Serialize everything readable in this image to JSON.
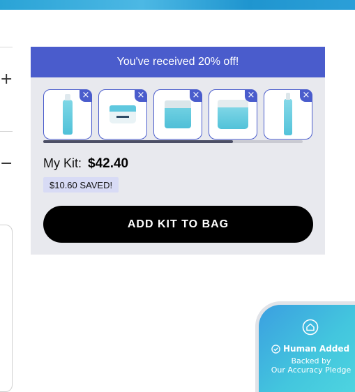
{
  "header_banner": {},
  "left_controls": {
    "expand_symbol": "+",
    "collapse_symbol": "−"
  },
  "kit": {
    "discount_message": "You've received 20% off!",
    "items": [
      {
        "name": "toner-bottle",
        "icon": "product-bottle-icon"
      },
      {
        "name": "gel-cream-jar",
        "icon": "product-jar-icon"
      },
      {
        "name": "moisturizer-jar",
        "icon": "product-jar-icon"
      },
      {
        "name": "cleansing-balm-jar",
        "icon": "product-jar-icon"
      },
      {
        "name": "serum-bottle",
        "icon": "product-bottle-icon"
      }
    ],
    "remove_symbol": "×",
    "scroll_position_fraction": 0.73,
    "total_label": "My Kit:",
    "total_value": "$42.40",
    "saved_text": "$10.60 SAVED!",
    "add_button_label": "ADD KIT TO BAG"
  },
  "pledge": {
    "title": "Human Added",
    "line1": "Backed by",
    "line2": "Our Accuracy Pledge"
  },
  "colors": {
    "accent": "#4a5ccc",
    "button": "#000000",
    "panel_bg": "#e8e9ee",
    "badge_bg": "#d8dbf5"
  }
}
